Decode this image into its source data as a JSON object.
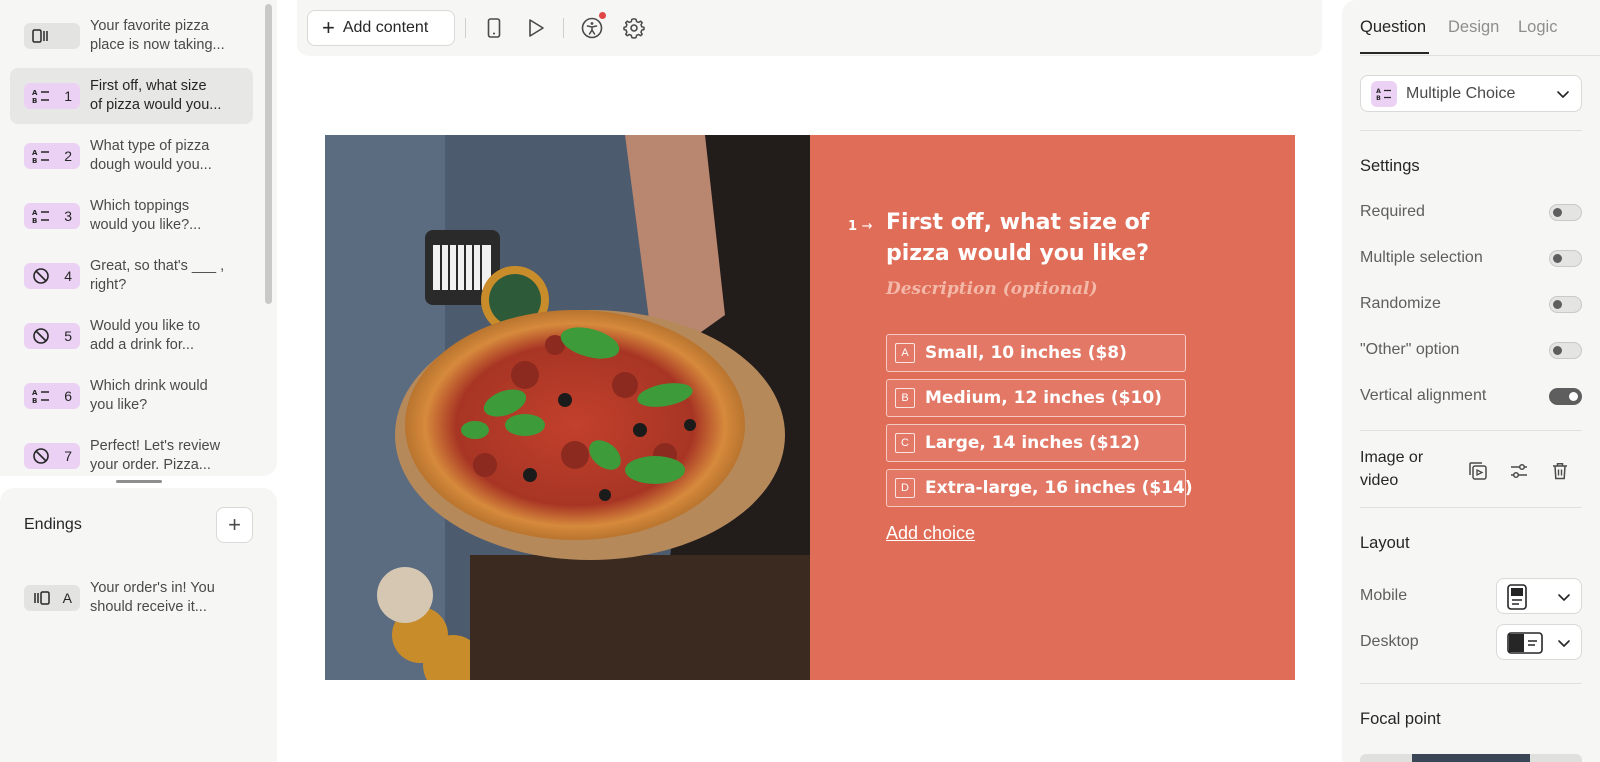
{
  "sidebar": {
    "questions": [
      {
        "num": "",
        "line1": "Your favorite pizza",
        "line2": "place is now taking...",
        "icon": "welcome-screen-icon",
        "badge": "gray",
        "active": false
      },
      {
        "num": "1",
        "line1": "First off, what size",
        "line2": "of pizza would you...",
        "icon": "multiple-choice-icon",
        "badge": "purple",
        "active": true
      },
      {
        "num": "2",
        "line1": "What type of pizza",
        "line2": "dough would you...",
        "icon": "multiple-choice-icon",
        "badge": "purple",
        "active": false
      },
      {
        "num": "3",
        "line1": "Which toppings",
        "line2": "would you like?...",
        "icon": "multiple-choice-icon",
        "badge": "purple",
        "active": false
      },
      {
        "num": "4",
        "line1": "Great, so that's ___ ,",
        "line2": "right?",
        "icon": "yes-no-icon",
        "badge": "purple",
        "active": false
      },
      {
        "num": "5",
        "line1": "Would you like to",
        "line2": "add a drink for...",
        "icon": "yes-no-icon",
        "badge": "purple",
        "active": false
      },
      {
        "num": "6",
        "line1": "Which drink would",
        "line2": "you like?",
        "icon": "multiple-choice-icon",
        "badge": "purple",
        "active": false
      },
      {
        "num": "7",
        "line1": "Perfect! Let's review",
        "line2": "your order. Pizza...",
        "icon": "yes-no-icon",
        "badge": "purple",
        "active": false
      }
    ],
    "endings": {
      "title": "Endings",
      "add_label": "+",
      "items": [
        {
          "num": "A",
          "line1": "Your order's in! You",
          "line2": "should receive it...",
          "icon": "ending-screen-icon"
        }
      ]
    }
  },
  "toolbar": {
    "add_content_icon": "+",
    "add_content_label": "Add content",
    "icons": [
      "mobile-preview-icon",
      "play-icon",
      "accessibility-icon",
      "settings-gear-icon"
    ]
  },
  "form": {
    "question_number": "1",
    "title": "First off, what size of pizza would you like?",
    "description_placeholder": "Description (optional)",
    "choices": [
      {
        "key": "A",
        "label": "Small, 10 inches ($8)"
      },
      {
        "key": "B",
        "label": "Medium, 12 inches ($10)"
      },
      {
        "key": "C",
        "label": "Large, 14 inches ($12)"
      },
      {
        "key": "D",
        "label": "Extra-large, 16 inches ($14)"
      }
    ],
    "add_choice": "Add choice",
    "colors": {
      "background": "#e06d58",
      "text": "#ffffff",
      "description": "#f4b8a9"
    }
  },
  "panel": {
    "tabs": [
      "Question",
      "Design",
      "Logic"
    ],
    "active_tab": "Question",
    "question_type": "Multiple Choice",
    "settings_title": "Settings",
    "settings": [
      {
        "label": "Required",
        "on": false
      },
      {
        "label": "Multiple selection",
        "on": false
      },
      {
        "label": "Randomize",
        "on": false
      },
      {
        "label": "\"Other\" option",
        "on": false
      },
      {
        "label": "Vertical alignment",
        "on": true
      }
    ],
    "image_or_video": "Image or video",
    "layout_title": "Layout",
    "layout_mobile": "Mobile",
    "layout_desktop": "Desktop",
    "focal_point": "Focal point"
  }
}
